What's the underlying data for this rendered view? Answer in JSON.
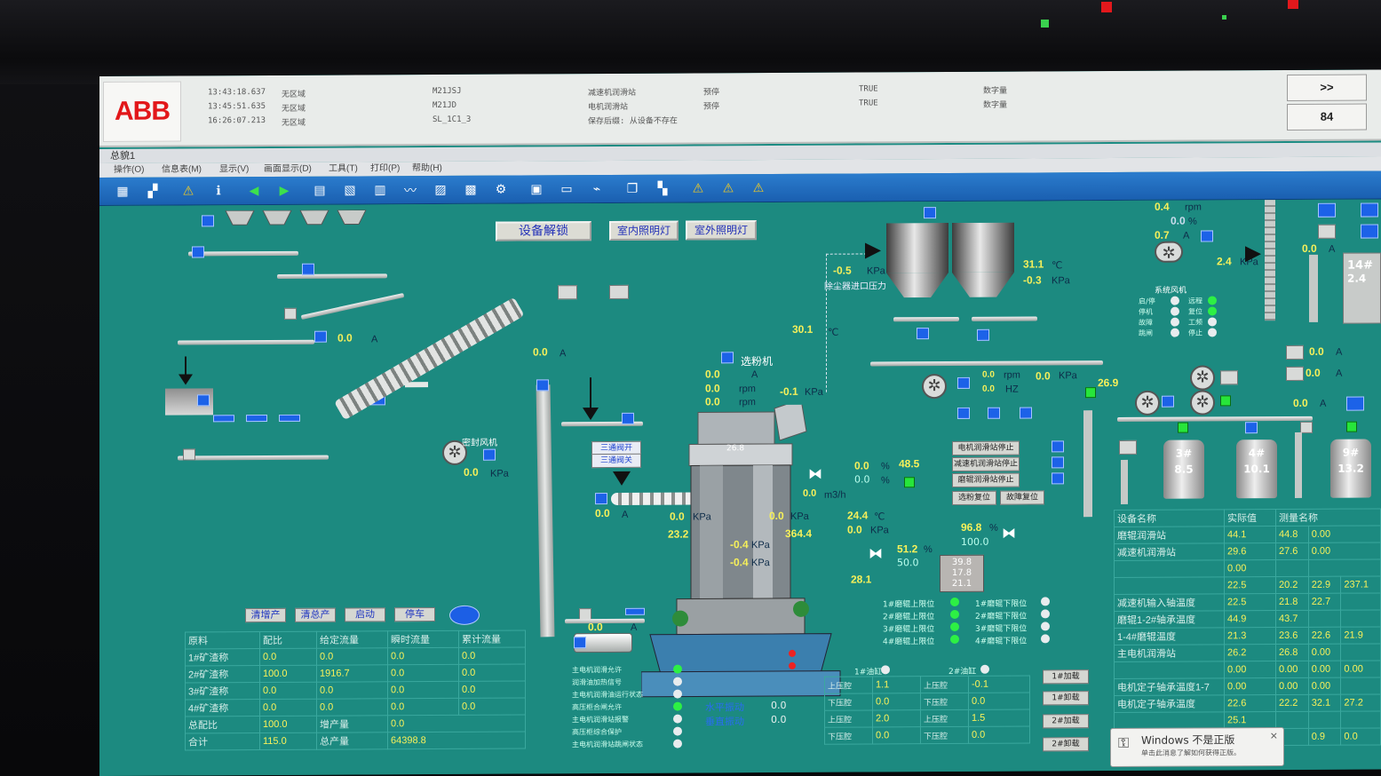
{
  "alarm": {
    "logo": "ABB",
    "rows": [
      {
        "time": "13:43:18.637",
        "area": "无区域",
        "tag": "M21JSJ",
        "desc": "减速机润滑站",
        "state": "预停",
        "value": "TRUE",
        "type": "数字量"
      },
      {
        "time": "13:45:51.635",
        "area": "无区域",
        "tag": "M21JD",
        "desc": "电机润滑站",
        "state": "预停",
        "value": "TRUE",
        "type": "数字量"
      },
      {
        "time": "16:26:07.213",
        "area": "无区域",
        "tag": "SL_1C1_3",
        "desc": "保存后缀: 从设备不存在",
        "state": "",
        "value": "",
        "type": ""
      }
    ],
    "nav_button": ">>",
    "count": "84"
  },
  "window": {
    "title": "总貌1",
    "menu": [
      "操作(O)",
      "信息表(M)",
      "显示(V)",
      "画面显示(D)",
      "工具(T)",
      "打印(P)",
      "帮助(H)"
    ]
  },
  "toolbar_icons": [
    "grid-icon",
    "layout-icon",
    "warning-icon",
    "info-icon",
    "back-icon",
    "forward-icon",
    "document-icon",
    "image-icon",
    "table-icon",
    "trend-icon",
    "chart-icon",
    "chart2-icon",
    "settings-icon",
    "report-icon",
    "panel-icon",
    "graph-icon",
    "window-icon",
    "tile-icon",
    "alarm-icon",
    "alarm2-icon",
    "alarm3-icon"
  ],
  "controls": {
    "unlock": "设备解锁",
    "indoor_light": "室内照明灯",
    "outdoor_light": "室外照明灯",
    "bottom_buttons": [
      "清增产",
      "清总产",
      "启动",
      "停车"
    ]
  },
  "process": {
    "feeder_a": "0.0",
    "conveyor_a": "0.0",
    "seal_fan_kpa": "0.0",
    "bucket_a": "0.0",
    "dust_inlet_kpa": "-0.5",
    "dust_inlet_label": "除尘器进口压力",
    "silo_temp": "31.1",
    "silo_kpa": "-0.3",
    "duct_temp": "30.1",
    "separator_label": "选粉机",
    "separator_a": "0.0",
    "separator_rpm1": "0.0",
    "separator_rpm2": "0.0",
    "separator_kpa": "-0.1",
    "fan_rpm": "0.0",
    "fan_kpa": "0.0",
    "fan_hz": "0.0",
    "fan_speed": "26.9",
    "sys_fan_rpm": "0.4",
    "sys_fan_pct": "0.0",
    "sys_fan_a": "0.7",
    "sys_fan_kpa": "2.4",
    "stack_a": "0.0",
    "screw_a": "0.0",
    "mill_top_temp": "26.8",
    "valve_pct": "0.0",
    "valve_pct_set": "0.0",
    "valve_a": "48.5",
    "water_flow": "0.0",
    "mill_kpa_l": "0.0",
    "mill_kpa_r": "0.0",
    "mill_temp_l": "23.2",
    "mill_temp_r": "364.4",
    "mill_dp1": "-0.4",
    "mill_dp2": "-0.4",
    "hot_temp": "24.4",
    "hot_kpa": "0.0",
    "valve2_pct": "96.8",
    "valve2_set": "100.0",
    "valve3_pct": "51.2",
    "valve3_set": "50.0",
    "hot_temp2": "28.1",
    "gauge": [
      "39.8",
      "17.8",
      "21.1"
    ],
    "motor_a": "0.0",
    "lube_buttons": [
      "电机润滑站停止",
      "减速机润滑站停止",
      "磨辊润滑站停止",
      "选粉复位",
      "故障复位"
    ],
    "bucket2_a": "0.0",
    "tanks": [
      {
        "name": "3#",
        "val": "8.5"
      },
      {
        "name": "4#",
        "val": "10.1"
      },
      {
        "name": "9#",
        "val": "13.2"
      }
    ],
    "right_vals": [
      "0.0",
      "0.0",
      "0.0",
      "0.0"
    ],
    "box14": [
      "14#",
      "2.4"
    ],
    "sys_label": "系统风机",
    "sys_states": [
      "启/停",
      "运行",
      "停机",
      "故障",
      "跳闸"
    ],
    "sys_states2": [
      "远程",
      "复位",
      "工频",
      "停止"
    ],
    "seal_label": "密封风机",
    "screw_labels": [
      "三通阀开",
      "三通阀关"
    ]
  },
  "bottom_table": {
    "headers": [
      "原料",
      "配比",
      "给定流量",
      "瞬时流量",
      "累计流量"
    ],
    "rows": [
      {
        "name": "1#矿渣称",
        "ratio": "0.0",
        "set": "0.0",
        "inst": "0.0",
        "total": "0.0"
      },
      {
        "name": "2#矿渣称",
        "ratio": "100.0",
        "set": "1916.7",
        "inst": "0.0",
        "total": "0.0"
      },
      {
        "name": "3#矿渣称",
        "ratio": "0.0",
        "set": "0.0",
        "inst": "0.0",
        "total": "0.0"
      },
      {
        "name": "4#矿渣称",
        "ratio": "0.0",
        "set": "0.0",
        "inst": "0.0",
        "total": "0.0"
      }
    ],
    "total_ratio_label": "总配比",
    "total_ratio": "100.0",
    "prod_label": "增产量",
    "prod": "0.0",
    "sum_label": "合计",
    "sum": "115.0",
    "total_prod_label": "总产量",
    "total_prod": "64398.8",
    "unit_pct": "%",
    "unit_kgh": "kg/h",
    "unit_t": "t"
  },
  "motor_panel": {
    "items": [
      "主电机润滑允许",
      "润滑油加热信号",
      "主电机润滑油运行状态",
      "高压柜合闸允许",
      "主电机润滑站报警",
      "高压柜综合保护",
      "主电机润滑站跳闸状态"
    ],
    "level_label": "水平振动",
    "level_val": "0.0",
    "vert_label": "垂直振动",
    "vert_val": "0.0"
  },
  "roller_panel": {
    "items": [
      "1#磨辊上限位",
      "2#磨辊上限位",
      "3#磨辊上限位",
      "4#磨辊上限位"
    ],
    "items2": [
      "1#磨辊下限位",
      "2#磨辊下限位",
      "3#磨辊下限位",
      "4#磨辊下限位"
    ],
    "oil_labels": [
      "1#油缸",
      "2#油缸"
    ],
    "press_rows": [
      {
        "l": "上压腔",
        "a": "1.1",
        "b": "-0.1"
      },
      {
        "l": "下压腔",
        "a": "0.0",
        "b": "0.0"
      },
      {
        "l": "上压腔",
        "a": "2.0",
        "b": "1.5"
      },
      {
        "l": "下压腔",
        "a": "0.0",
        "b": "0.0"
      }
    ],
    "buttons": [
      "1#加载",
      "1#卸载",
      "2#加载",
      "2#卸载"
    ]
  },
  "right_table": {
    "headers": [
      "设备名称",
      "实际值",
      "测量名称"
    ],
    "rows": [
      {
        "name": "磨辊润滑站",
        "vals": [
          "44.1",
          "44.8",
          "0.00"
        ]
      },
      {
        "name": "减速机润滑站",
        "vals": [
          "29.6",
          "27.6",
          "0.00"
        ]
      },
      {
        "name": "",
        "vals": [
          "0.00",
          "",
          ""
        ]
      },
      {
        "name": "",
        "vals": [
          "22.5",
          "20.2",
          "22.9",
          "237.1"
        ]
      },
      {
        "name": "减速机输入轴温度",
        "vals": [
          "22.5",
          "21.8",
          "22.7",
          ""
        ]
      },
      {
        "name": "磨辊1-2#轴承温度",
        "vals": [
          "44.9",
          "43.7",
          "",
          ""
        ]
      },
      {
        "name": "1-4#磨辊温度",
        "vals": [
          "21.3",
          "23.6",
          "22.6",
          "21.9"
        ]
      },
      {
        "name": "主电机润滑站",
        "vals": [
          "26.2",
          "26.8",
          "0.00",
          ""
        ]
      },
      {
        "name": "",
        "vals": [
          "0.00",
          "0.00",
          "0.00",
          "0.00"
        ]
      },
      {
        "name": "电机定子轴承温度1-7",
        "vals": [
          "0.00",
          "0.00",
          "0.00",
          ""
        ]
      },
      {
        "name": "电机定子轴承温度",
        "vals": [
          "22.6",
          "22.2",
          "32.1",
          "27.2"
        ]
      },
      {
        "name": "",
        "vals": [
          "25.1",
          "",
          "",
          ""
        ]
      },
      {
        "name": "",
        "vals": [
          "",
          "",
          "0.9",
          "0.0"
        ]
      }
    ]
  },
  "notice": {
    "title": "Windows 不是正版",
    "body": "单击此消息了解如何获得正版。"
  },
  "colors": {
    "bg": "#1c8a80",
    "accent": "#1c62e8",
    "value": "#f6f05a",
    "ok": "#27e53a"
  }
}
